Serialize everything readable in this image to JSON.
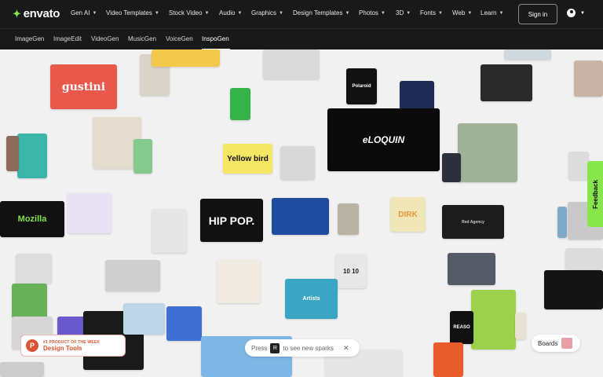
{
  "brand": {
    "name": "envato"
  },
  "nav": {
    "items": [
      {
        "label": "Gen AI",
        "name": "gen-ai"
      },
      {
        "label": "Video Templates",
        "name": "video-templates"
      },
      {
        "label": "Stock Video",
        "name": "stock-video"
      },
      {
        "label": "Audio",
        "name": "audio"
      },
      {
        "label": "Graphics",
        "name": "graphics"
      },
      {
        "label": "Design Templates",
        "name": "design-templates"
      },
      {
        "label": "Photos",
        "name": "photos"
      },
      {
        "label": "3D",
        "name": "3d"
      },
      {
        "label": "Fonts",
        "name": "fonts"
      },
      {
        "label": "Web",
        "name": "web"
      },
      {
        "label": "Learn",
        "name": "learn"
      }
    ],
    "signin": "Sign in"
  },
  "subnav": {
    "items": [
      "ImageGen",
      "ImageEdit",
      "VideoGen",
      "MusicGen",
      "VoiceGen",
      "InspoGen"
    ],
    "active": "InspoGen"
  },
  "tiles": [
    {
      "name": "tile-gustini",
      "text": "gustini",
      "bg": "#e8594b",
      "fg": "#ffffff"
    },
    {
      "name": "tile-polaroid",
      "text": "Polaroid",
      "bg": "#111111",
      "fg": "#ffffff"
    },
    {
      "name": "tile-yellowbird",
      "text": "Yellow bird",
      "bg": "#f5e663",
      "fg": "#111111"
    },
    {
      "name": "tile-hiphop",
      "text": "HIP POP.",
      "bg": "#111111",
      "fg": "#ffffff"
    },
    {
      "name": "tile-mozilla",
      "text": "Mozilla",
      "bg": "#111111",
      "fg": "#7ee14a"
    },
    {
      "name": "tile-eloquin",
      "text": "eLOQUIN",
      "bg": "#0a0a0a",
      "fg": "#ffffff"
    },
    {
      "name": "tile-dirk",
      "text": "DIRK",
      "bg": "#f1e6b8",
      "fg": "#e8963a"
    },
    {
      "name": "tile-ad-agency",
      "text": "Red Agency",
      "bg": "#1c1c1c",
      "fg": "#cccccc"
    },
    {
      "name": "tile-clock",
      "text": "10 10",
      "bg": "#e8e8e8",
      "fg": "#222222"
    },
    {
      "name": "tile-reason",
      "text": "REASO",
      "bg": "#111111",
      "fg": "#ffffff"
    },
    {
      "name": "tile-poster-badge",
      "text": "Artists",
      "bg": "#3aa6c4",
      "fg": "#ffffff"
    }
  ],
  "badge": {
    "line1": "#1 PRODUCT OF THE WEEK",
    "line2": "Design Tools",
    "icon": "P"
  },
  "spark": {
    "before": "Press",
    "key": "R",
    "after": "to see new sparks"
  },
  "boards": {
    "label": "Boards"
  },
  "feedback": {
    "label": "Feedback"
  }
}
